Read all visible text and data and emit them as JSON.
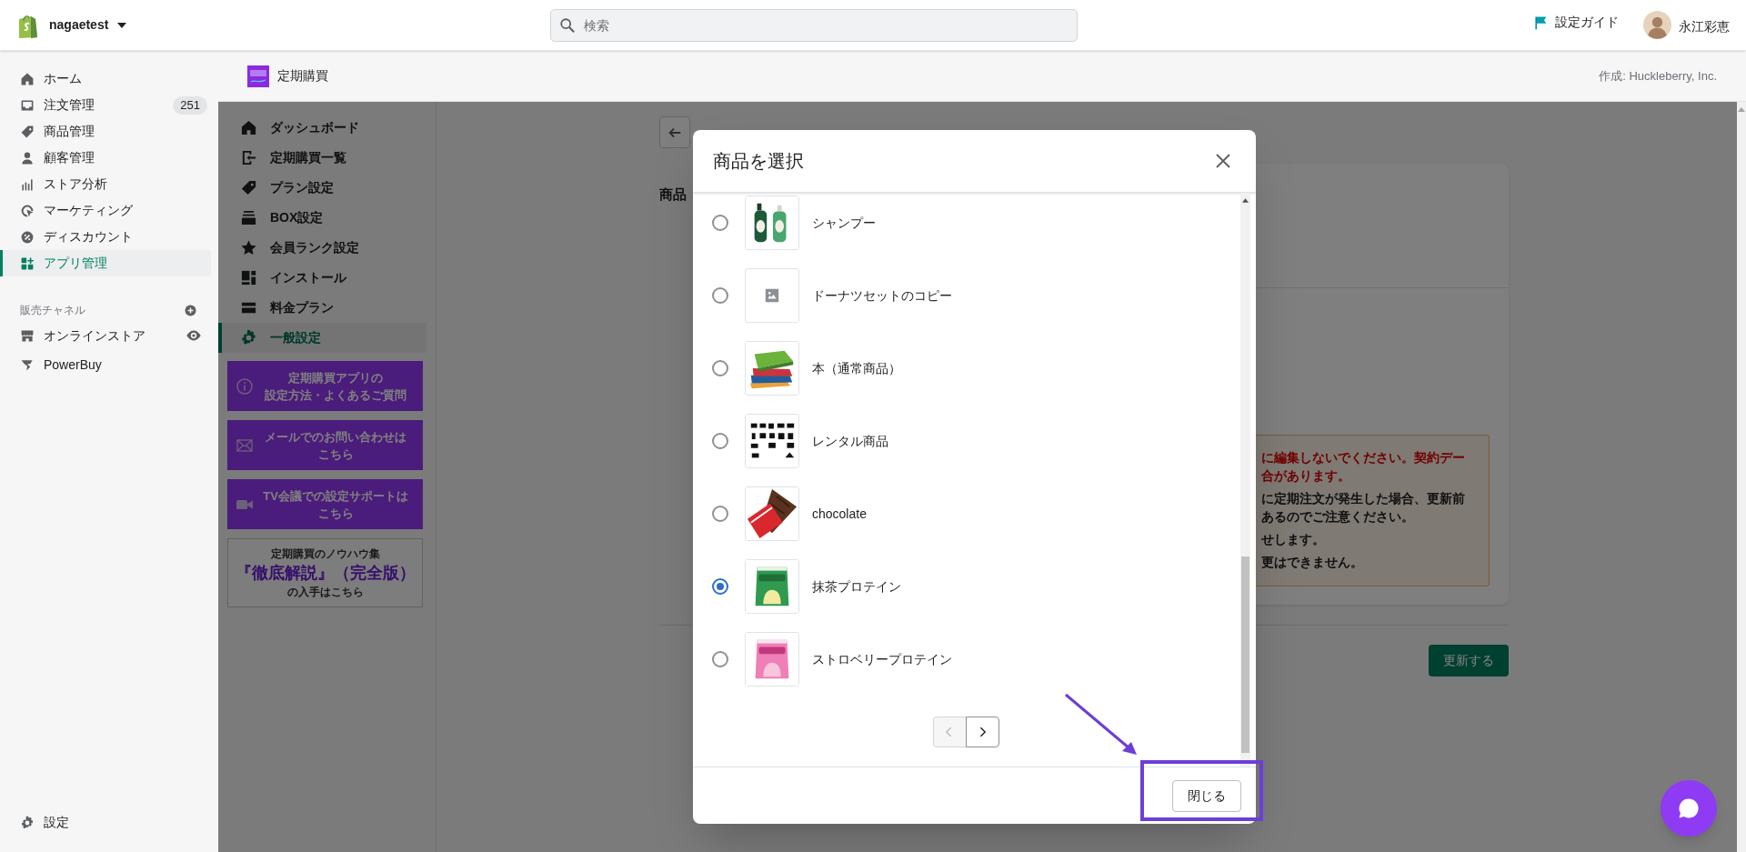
{
  "topbar": {
    "store_name": "nagaetest",
    "search": {
      "placeholder": "検索"
    },
    "setup_guide": "設定ガイド",
    "user_name": "永江彩恵"
  },
  "sidebar": {
    "items": [
      {
        "label": "ホーム",
        "selected": false
      },
      {
        "label": "注文管理",
        "badge": "251",
        "selected": false
      },
      {
        "label": "商品管理",
        "selected": false
      },
      {
        "label": "顧客管理",
        "selected": false
      },
      {
        "label": "ストア分析",
        "selected": false
      },
      {
        "label": "マーケティング",
        "selected": false
      },
      {
        "label": "ディスカウント",
        "selected": false
      },
      {
        "label": "アプリ管理",
        "selected": true
      }
    ],
    "sales_channels": {
      "title": "販売チャネル",
      "items": [
        {
          "label": "オンラインストア"
        },
        {
          "label": "PowerBuy"
        }
      ]
    },
    "settings": "設定"
  },
  "app": {
    "title": "定期購買",
    "credit": "作成: Huckleberry, Inc.",
    "nav": [
      {
        "label": "ダッシュボード",
        "selected": false
      },
      {
        "label": "定期購買一覧",
        "selected": false
      },
      {
        "label": "プラン設定",
        "selected": false
      },
      {
        "label": "BOX設定",
        "selected": false
      },
      {
        "label": "会員ランク設定",
        "selected": false
      },
      {
        "label": "インストール",
        "selected": false
      },
      {
        "label": "料金プラン",
        "selected": false
      },
      {
        "label": "一般設定",
        "selected": true
      }
    ],
    "help_links": [
      {
        "lines": [
          "定期購買アプリの",
          "設定方法・よくあるご質問"
        ]
      },
      {
        "lines": [
          "メールでのお問い合わせは",
          "こちら"
        ]
      },
      {
        "lines": [
          "TV会議での設定サポートは",
          "こちら"
        ]
      }
    ],
    "knowhow": {
      "title": "定期購買のノウハウ集",
      "highlight": "『徹底解説』（完全版）",
      "note": "の入手はこちら"
    }
  },
  "page": {
    "section_heading": "商品",
    "warning": {
      "paragraphs": [
        {
          "kind": "alert",
          "lines": [
            "に編集しないでください。契約デー",
            "合があります。"
          ]
        },
        {
          "kind": "note",
          "lines": [
            "に定期注文が発生した場合、更新前",
            "あるのでご注意ください。"
          ]
        },
        {
          "kind": "note",
          "lines": [
            "せします。"
          ]
        },
        {
          "kind": "note",
          "lines": [
            "更はできません。"
          ]
        }
      ]
    },
    "update_button": "更新する"
  },
  "modal": {
    "title": "商品を選択",
    "products": [
      {
        "name": "シャンプー",
        "kind": "picture",
        "selected": false
      },
      {
        "name": "ドーナツセットのコピー",
        "kind": "placeholder",
        "selected": false
      },
      {
        "name": "本（通常商品）",
        "kind": "picture",
        "selected": false
      },
      {
        "name": "レンタル商品",
        "kind": "picture",
        "selected": false
      },
      {
        "name": "chocolate",
        "kind": "picture",
        "selected": false
      },
      {
        "name": "抹茶プロテイン",
        "kind": "picture",
        "selected": true
      },
      {
        "name": "ストロベリープロテイン",
        "kind": "picture",
        "selected": false
      }
    ],
    "pagination": [
      {
        "kind": "previous",
        "disabled": true
      },
      {
        "kind": "next",
        "disabled": false
      }
    ],
    "close_button": "閉じる"
  }
}
